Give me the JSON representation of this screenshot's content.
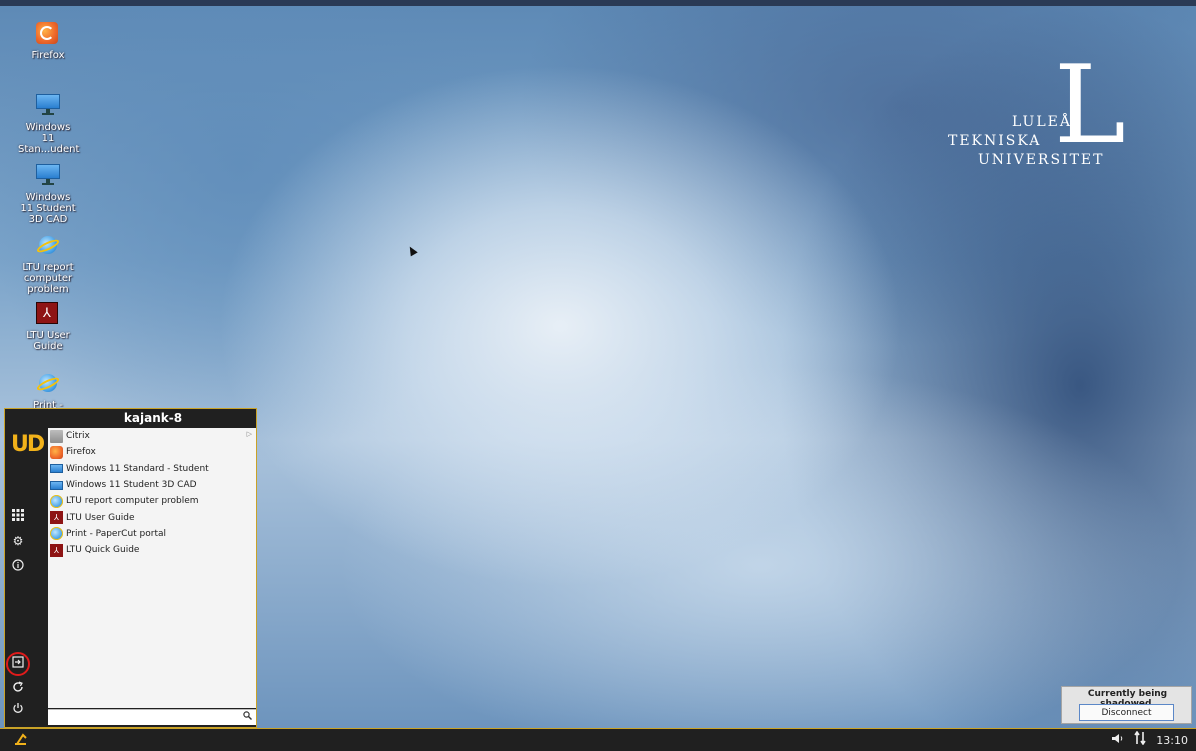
{
  "desktop": {
    "icons": [
      {
        "label": "Firefox",
        "icon": "firefox-icon"
      },
      {
        "label": "Windows 11 Stan...udent",
        "icon": "monitor-icon"
      },
      {
        "label": "Windows 11 Student 3D CAD",
        "icon": "monitor-icon"
      },
      {
        "label": "LTU report computer problem",
        "icon": "internet-explorer-icon"
      },
      {
        "label": "LTU User Guide",
        "icon": "pdf-icon"
      },
      {
        "label": "Print -",
        "icon": "internet-explorer-icon"
      }
    ],
    "logo": {
      "line1": "LULEÅ",
      "line2": "TEKNISKA",
      "line3": "UNIVERSITET",
      "mark": "L"
    }
  },
  "start_menu": {
    "header": "kajank-8",
    "brand": "UD",
    "items": [
      {
        "label": "Citrix",
        "icon": "folder-icon",
        "has_submenu": true,
        "arrow": "▷"
      },
      {
        "label": "Firefox",
        "icon": "firefox-icon"
      },
      {
        "label": "Windows 11 Standard - Student",
        "icon": "monitor-icon"
      },
      {
        "label": "Windows 11 Student 3D CAD",
        "icon": "monitor-icon"
      },
      {
        "label": "LTU report computer problem",
        "icon": "internet-explorer-icon"
      },
      {
        "label": "LTU User Guide",
        "icon": "pdf-icon"
      },
      {
        "label": "Print - PaperCut portal",
        "icon": "internet-explorer-icon"
      },
      {
        "label": "LTU Quick Guide",
        "icon": "pdf-icon"
      }
    ],
    "sidebar_icons": [
      "apps-grid-icon",
      "settings-gear-icon",
      "info-icon",
      "logout-icon",
      "restart-icon",
      "power-icon"
    ],
    "search": {
      "value": "",
      "placeholder": ""
    },
    "highlight_color": "#e01b1b",
    "accent_color": "#f2b21a"
  },
  "shadow_notice": {
    "message": "Currently being shadowed.",
    "button_label": "Disconnect"
  },
  "taskbar": {
    "clock": "13:10",
    "tray_icons": [
      "volume-icon",
      "network-icon"
    ]
  }
}
